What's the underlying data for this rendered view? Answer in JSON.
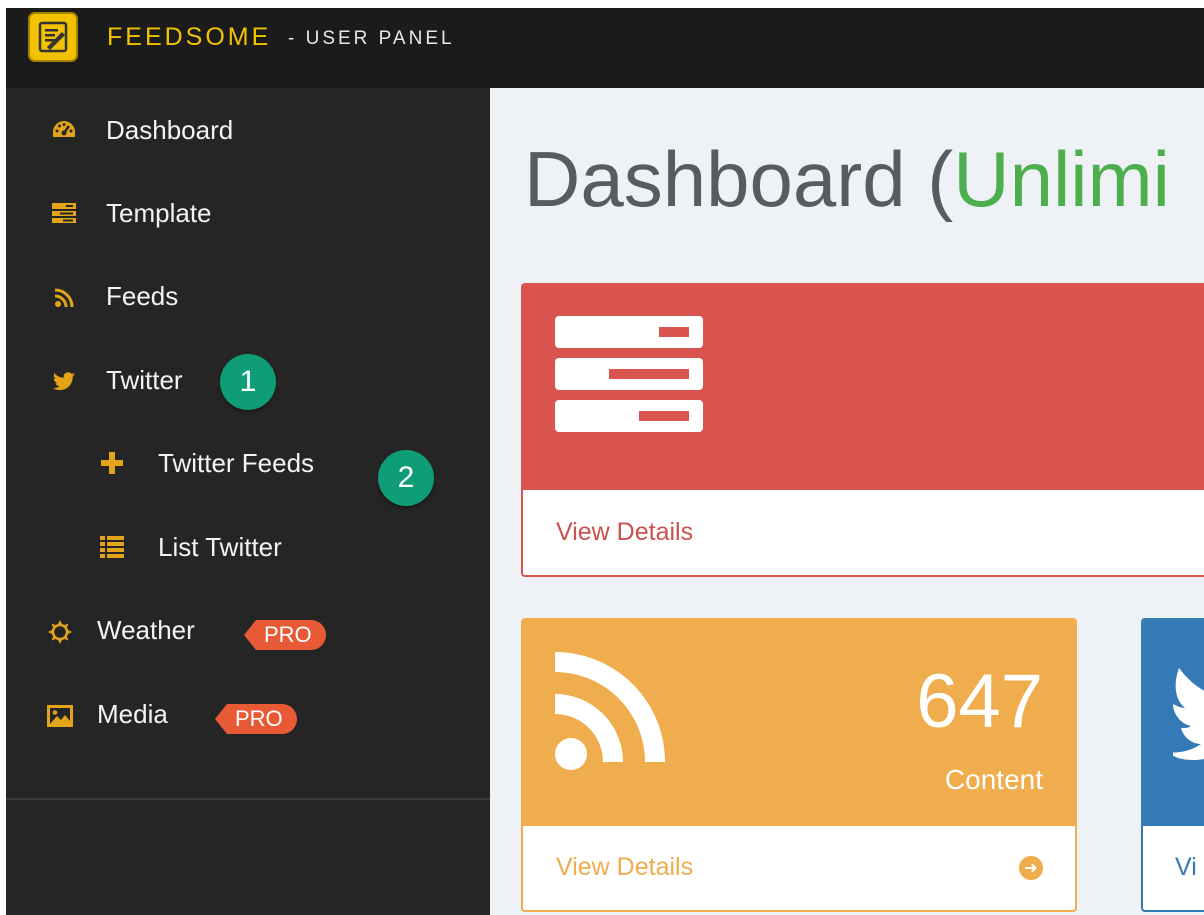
{
  "app": {
    "brand": "FEEDSOME",
    "brand_suffix": "- USER PANEL"
  },
  "sidebar": {
    "items": [
      {
        "label": "Dashboard",
        "icon": "dashboard-icon"
      },
      {
        "label": "Template",
        "icon": "template-icon"
      },
      {
        "label": "Feeds",
        "icon": "rss-icon"
      },
      {
        "label": "Twitter",
        "icon": "twitter-icon"
      },
      {
        "label": "Twitter Feeds",
        "icon": "plus-icon"
      },
      {
        "label": "List Twitter",
        "icon": "list-icon"
      },
      {
        "label": "Weather",
        "icon": "sun-icon",
        "badge": "PRO"
      },
      {
        "label": "Media",
        "icon": "image-icon",
        "badge": "PRO"
      }
    ],
    "callouts": [
      "1",
      "2"
    ]
  },
  "main": {
    "title_prefix": "Dashboard (",
    "title_highlight": "Unlimi",
    "panels": [
      {
        "footer": "View Details",
        "color": "#d9534f",
        "icon": "template-icon"
      },
      {
        "count": "647",
        "label": "Content",
        "footer": "View Details",
        "color": "#f0ad4e",
        "icon": "rss-icon"
      },
      {
        "footer": "Vi",
        "color": "#337ab7",
        "icon": "twitter-icon"
      }
    ]
  },
  "colors": {
    "brand": "#f2c200",
    "badge_green": "#0f9d78",
    "pro_badge": "#e85a35",
    "title_highlight": "#4cae4c"
  }
}
